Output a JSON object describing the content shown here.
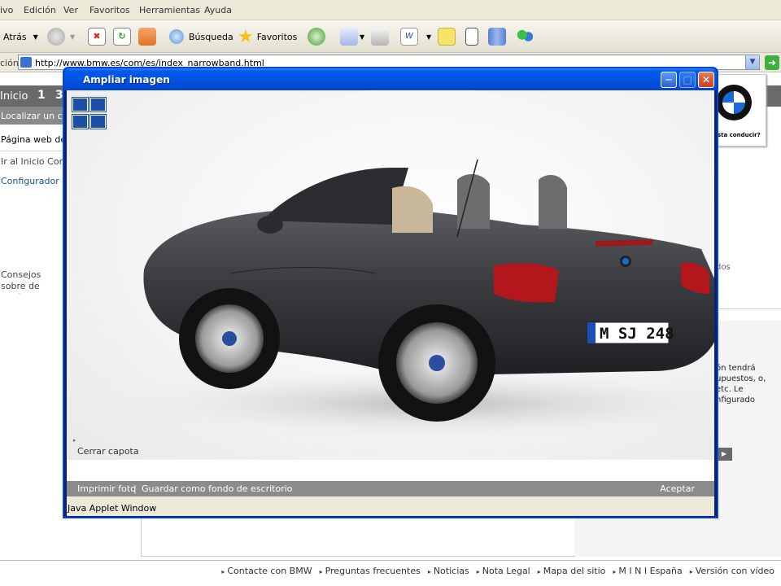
{
  "menubar": {
    "items": [
      "ivo",
      "Edición",
      "Ver",
      "Favoritos",
      "Herramientas",
      "Ayuda"
    ]
  },
  "toolbar": {
    "back_label": "Atrás",
    "search_label": "Búsqueda",
    "favorites_label": "Favoritos"
  },
  "addressbar": {
    "label": "ción",
    "url": "http://www.bmw.es/com/es/index_narrowband.html"
  },
  "page": {
    "nav": {
      "inicio": "Inicio",
      "step1": "1",
      "step3": "3"
    },
    "sidebar": {
      "localizar": "Localizar un con",
      "pagina_web": "Página web de E",
      "ir_inicio": "Ir al Inicio Conce",
      "configurador": "Configurador de",
      "consejos": "Consejos sobre de vehículo"
    },
    "bmw_tagline": "usta conducir?",
    "right": {
      "dos": "dos",
      "para": "ón tendrá upuestos, o, etc. Le nfigurado"
    },
    "footer": [
      "Contacte con BMW",
      "Preguntas frecuentes",
      "Noticias",
      "Nota Legal",
      "Mapa del sitio",
      "M I N I España",
      "Versión con vídeo"
    ]
  },
  "dialog": {
    "title": "Ampliar imagen",
    "cerrar_capota": "Cerrar capota",
    "print_label": "Imprimir foto",
    "separator": "|",
    "wallpaper_label": "Guardar como fondo de escritorio",
    "accept_label": "Aceptar",
    "applet_label": "Java Applet Window",
    "plate": "M SJ 248"
  }
}
